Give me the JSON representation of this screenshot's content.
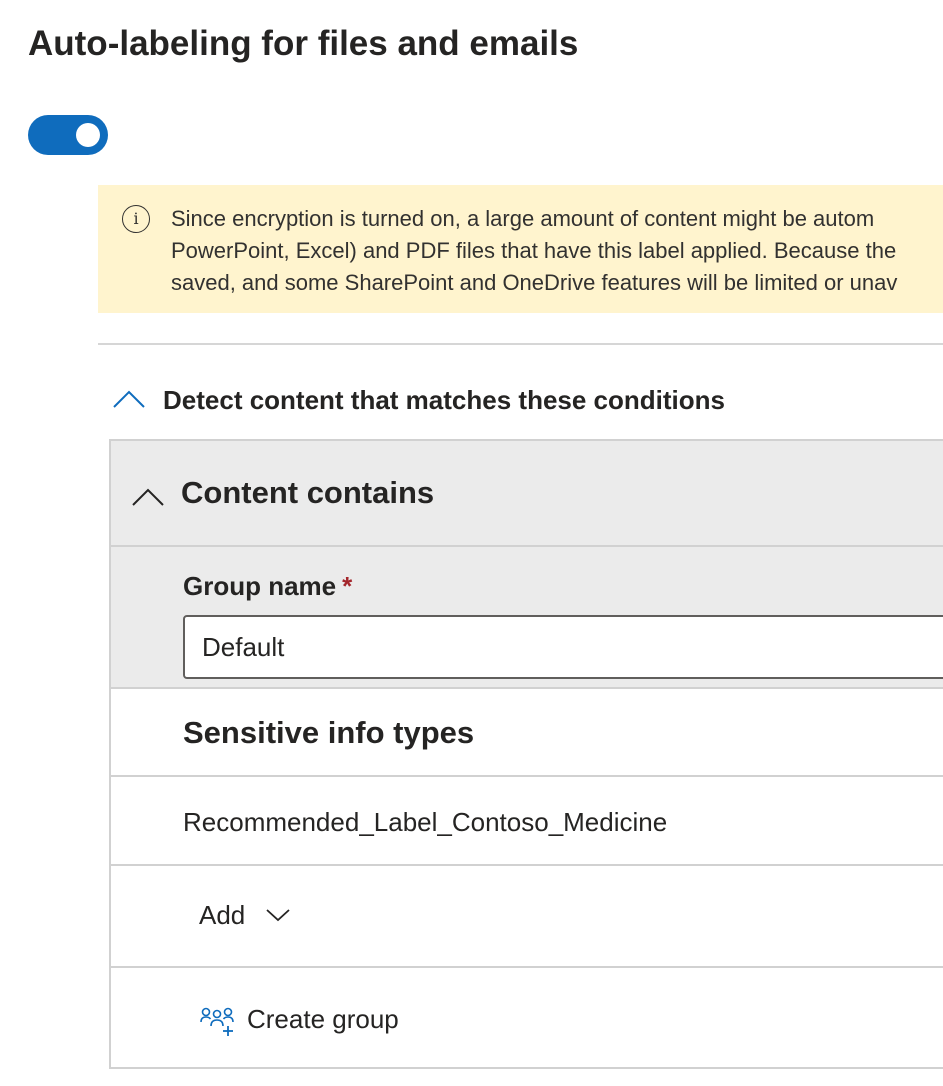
{
  "page": {
    "title": "Auto-labeling for files and emails"
  },
  "toggle": {
    "state": "on",
    "accent": "#0f6cbd"
  },
  "banner": {
    "icon": "info-icon",
    "lines": [
      "Since encryption is turned on, a large amount of content might be autom",
      "PowerPoint, Excel) and PDF files that have this label applied. Because the",
      "saved, and some SharePoint and OneDrive features will be limited or unav"
    ],
    "background": "#fff4ce"
  },
  "conditions": {
    "header": "Detect content that matches these conditions",
    "icon": "chevron-up-icon",
    "icon_color": "#0f6cbd"
  },
  "content_contains": {
    "header": "Content contains",
    "icon": "chevron-up-icon",
    "group_name_label": "Group name",
    "required_marker": "*",
    "group_name_value": "Default",
    "sensitive_info_types_label": "Sensitive info types",
    "sensitive_info_types": [
      "Recommended_Label_Contoso_Medicine"
    ],
    "add_label": "Add",
    "add_icon": "chevron-down-icon",
    "create_group_label": "Create group",
    "create_group_icon": "add-group-icon"
  }
}
